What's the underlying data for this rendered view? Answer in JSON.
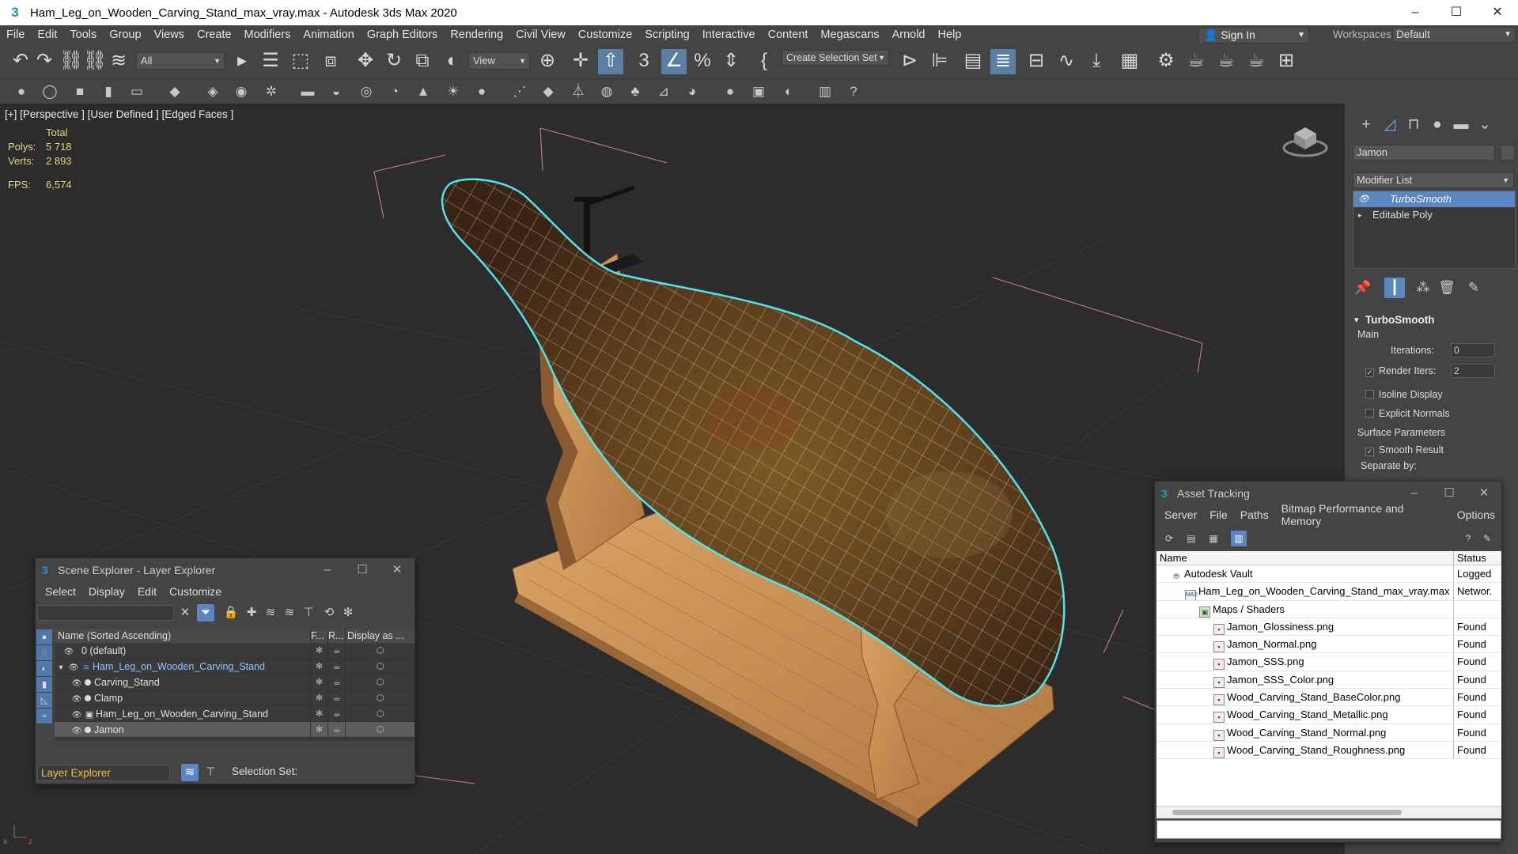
{
  "window": {
    "title": "Ham_Leg_on_Wooden_Carving_Stand_max_vray.max - Autodesk 3ds Max 2020",
    "app_icon": "3ds-max-logo-icon",
    "controls": [
      "–",
      "☐",
      "✕"
    ]
  },
  "menu": [
    "File",
    "Edit",
    "Tools",
    "Group",
    "Views",
    "Create",
    "Modifiers",
    "Animation",
    "Graph Editors",
    "Rendering",
    "Civil View",
    "Customize",
    "Scripting",
    "Interactive",
    "Content",
    "Megascans",
    "Arnold",
    "Help"
  ],
  "signin": {
    "label": "Sign In"
  },
  "workspaces": {
    "label": "Workspaces:",
    "value": "Default"
  },
  "toolbar": {
    "filter_value": "All",
    "refcoord_value": "View",
    "selection_set_placeholder": "Create Selection Set"
  },
  "viewport": {
    "label": "[+] [Perspective ] [User Defined ] [Edged Faces ]",
    "stats": {
      "header": "Total",
      "polys_label": "Polys:",
      "polys_value": "5 718",
      "verts_label": "Verts:",
      "verts_value": "2 893",
      "fps_label": "FPS:",
      "fps_value": "6,574"
    }
  },
  "command_panel": {
    "object_name": "Jamon",
    "modifier_list_label": "Modifier List",
    "stack": [
      {
        "label": "TurboSmooth",
        "selected": true
      },
      {
        "label": "Editable Poly",
        "selected": false
      }
    ],
    "turbosmooth": {
      "title": "TurboSmooth",
      "main_label": "Main",
      "iterations_label": "Iterations:",
      "iterations_value": "0",
      "render_iters_label": "Render Iters:",
      "render_iters_value": "2",
      "isoline_label": "Isoline Display",
      "explicit_normals_label": "Explicit Normals",
      "surface_params_label": "Surface Parameters",
      "smooth_result_label": "Smooth Result",
      "separate_by_label": "Separate by:"
    }
  },
  "scene_explorer": {
    "title": "Scene Explorer - Layer Explorer",
    "menu": [
      "Select",
      "Display",
      "Edit",
      "Customize"
    ],
    "columns": {
      "name": "Name (Sorted Ascending)",
      "f": "F...",
      "r": "R...",
      "display": "Display as ..."
    },
    "rows": [
      {
        "name": "0 (default)",
        "indent": 0,
        "kind": "layer"
      },
      {
        "name": "Ham_Leg_on_Wooden_Carving_Stand",
        "indent": 0,
        "kind": "layer-open"
      },
      {
        "name": "Carving_Stand",
        "indent": 1,
        "kind": "object"
      },
      {
        "name": "Clamp",
        "indent": 1,
        "kind": "object"
      },
      {
        "name": "Ham_Leg_on_Wooden_Carving_Stand",
        "indent": 1,
        "kind": "group"
      },
      {
        "name": "Jamon",
        "indent": 1,
        "kind": "object"
      }
    ],
    "footer_dropdown": "Layer Explorer",
    "selection_set_label": "Selection Set:"
  },
  "asset_tracking": {
    "title": "Asset Tracking",
    "menu": [
      "Server",
      "File",
      "Paths",
      "Bitmap Performance and Memory",
      "Options"
    ],
    "columns": {
      "name": "Name",
      "status": "Status"
    },
    "rows": [
      {
        "name": "Autodesk Vault",
        "status": "Logged",
        "indent": 0,
        "icon": "vault"
      },
      {
        "name": "Ham_Leg_on_Wooden_Carving_Stand_max_vray.max",
        "status": "Networ.",
        "indent": 1,
        "icon": "max"
      },
      {
        "name": "Maps / Shaders",
        "status": "",
        "indent": 2,
        "icon": "folder"
      },
      {
        "name": "Jamon_Glossiness.png",
        "status": "Found",
        "indent": 3,
        "icon": "image"
      },
      {
        "name": "Jamon_Normal.png",
        "status": "Found",
        "indent": 3,
        "icon": "image"
      },
      {
        "name": "Jamon_SSS.png",
        "status": "Found",
        "indent": 3,
        "icon": "image"
      },
      {
        "name": "Jamon_SSS_Color.png",
        "status": "Found",
        "indent": 3,
        "icon": "image"
      },
      {
        "name": "Wood_Carving_Stand_BaseColor.png",
        "status": "Found",
        "indent": 3,
        "icon": "image"
      },
      {
        "name": "Wood_Carving_Stand_Metallic.png",
        "status": "Found",
        "indent": 3,
        "icon": "image"
      },
      {
        "name": "Wood_Carving_Stand_Normal.png",
        "status": "Found",
        "indent": 3,
        "icon": "image"
      },
      {
        "name": "Wood_Carving_Stand_Roughness.png",
        "status": "Found",
        "indent": 3,
        "icon": "image"
      }
    ]
  },
  "colors": {
    "ui_bg": "#444444",
    "viewport_bg": "#2c2c2c",
    "selection_blue": "#5a86c2",
    "stats_yellow": "#e2d87a",
    "selection_outline": "#4fe3ee",
    "wood": "#c8925a",
    "ham": "#6a4a22"
  }
}
